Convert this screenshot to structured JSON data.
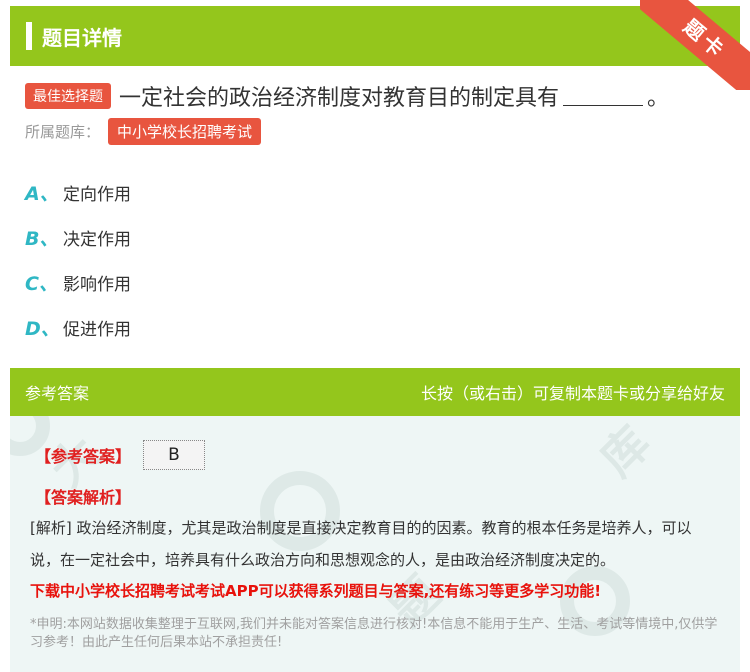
{
  "header": {
    "title": "题目详情",
    "ribbon": "题卡"
  },
  "question": {
    "tag": "最佳选择题",
    "text_before": "一定社会的政治经济制度对教育目的制定具有",
    "text_after": "。",
    "library_label": "所属题库：",
    "library_name": "中小学校长招聘考试"
  },
  "options": [
    {
      "letter": "A、",
      "text": "定向作用"
    },
    {
      "letter": "B、",
      "text": "决定作用"
    },
    {
      "letter": "C、",
      "text": "影响作用"
    },
    {
      "letter": "D、",
      "text": "促进作用"
    }
  ],
  "answer_section": {
    "title": "参考答案",
    "hint": "长按（或右击）可复制本题卡或分享给好友",
    "answer_label": "【参考答案】",
    "answer_value": "B",
    "analysis_label": "【答案解析】",
    "analysis_text": "[解析] 政治经济制度，尤其是政治制度是直接决定教育目的的因素。教育的根本任务是培养人，可以说，在一定社会中，培养具有什么政治方向和思想观念的人，是由政治经济制度决定的。",
    "download_text": "下载中小学校长招聘考试考试APP可以获得系列题目与答案,还有练习等更多学习功能!",
    "disclaimer": "*申明:本网站数据收集整理于互联网,我们并未能对答案信息进行核对!本信息不能用于生产、生活、考试等情境中,仅供学习参考！由此产生任何后果本站不承担责任!"
  },
  "colors": {
    "accent_green": "#94c61c",
    "tag_red": "#e8553f",
    "option_teal": "#2fb7c4",
    "answer_red": "#e02020"
  }
}
